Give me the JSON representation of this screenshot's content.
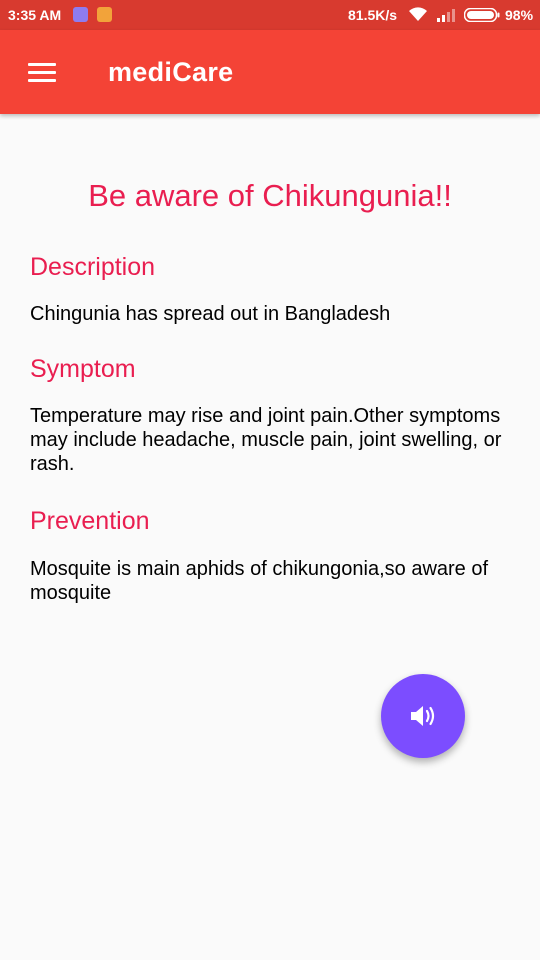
{
  "status_bar": {
    "time": "3:35 AM",
    "net_speed": "81.5K/s",
    "battery": "98%"
  },
  "app_bar": {
    "title": "mediCare",
    "menu_icon": "hamburger-menu-icon",
    "color": "#f44336"
  },
  "content": {
    "heading": "Be aware of Chikungunia!!",
    "sections": [
      {
        "title": "Description",
        "body": "Chingunia has spread out in Bangladesh"
      },
      {
        "title": "Symptom",
        "body": "Temperature may rise and joint pain.Other symptoms may include headache, muscle pain, joint swelling, or rash."
      },
      {
        "title": "Prevention",
        "body": "Mosquite is main aphids of chikungonia,so aware of mosquite"
      }
    ],
    "accent_color": "#e91e50"
  },
  "fab": {
    "icon": "speaker-volume-icon",
    "color": "#7c4dff"
  }
}
